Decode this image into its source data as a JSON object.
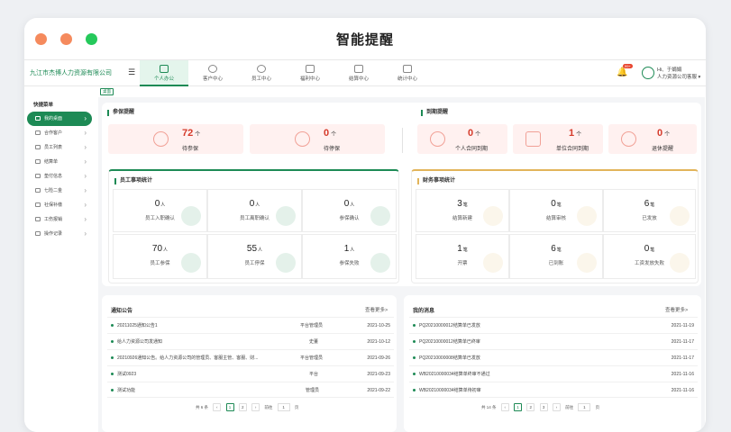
{
  "window": {
    "title": "智能提醒"
  },
  "topnav": {
    "company": "九江市杰博人力资源有限公司",
    "tabs": [
      {
        "label": "个人办公"
      },
      {
        "label": "客户中心"
      },
      {
        "label": "员工中心"
      },
      {
        "label": "福利中心"
      },
      {
        "label": "结算中心"
      },
      {
        "label": "统计中心"
      }
    ],
    "badge": "99+",
    "greeting": "Hi、于娟娟",
    "user_role": "人力资源公司客服 ▾"
  },
  "breadcrumb": "桌面",
  "sidebar": {
    "header": "快捷菜单",
    "items": [
      {
        "label": "我的桌面"
      },
      {
        "label": "合作客户"
      },
      {
        "label": "员工列表"
      },
      {
        "label": "结算单"
      },
      {
        "label": "垫付信息"
      },
      {
        "label": "七险二金"
      },
      {
        "label": "社保补缴"
      },
      {
        "label": "工伤报销"
      },
      {
        "label": "操作记录"
      }
    ]
  },
  "insurance": {
    "title": "参保提醒",
    "items": [
      {
        "num": "72",
        "unit": "个",
        "label": "待参保"
      },
      {
        "num": "0",
        "unit": "个",
        "label": "待停保"
      }
    ]
  },
  "expiry": {
    "title": "到期提醒",
    "items": [
      {
        "num": "0",
        "unit": "个",
        "label": "个人合同到期"
      },
      {
        "num": "1",
        "unit": "个",
        "label": "单位合同到期"
      },
      {
        "num": "0",
        "unit": "个",
        "label": "退休提醒"
      }
    ]
  },
  "staff": {
    "title": "员工事项统计",
    "items": [
      {
        "num": "0",
        "unit": "人",
        "label": "员工入职确认"
      },
      {
        "num": "0",
        "unit": "人",
        "label": "员工离职确认"
      },
      {
        "num": "0",
        "unit": "人",
        "label": "参保确认"
      },
      {
        "num": "70",
        "unit": "人",
        "label": "员工参保"
      },
      {
        "num": "55",
        "unit": "人",
        "label": "员工停保"
      },
      {
        "num": "1",
        "unit": "人",
        "label": "参保失败"
      }
    ]
  },
  "finance": {
    "title": "财务事项统计",
    "items": [
      {
        "num": "3",
        "unit": "笔",
        "label": "结算新建"
      },
      {
        "num": "0",
        "unit": "笔",
        "label": "结算审核"
      },
      {
        "num": "6",
        "unit": "笔",
        "label": "已发放"
      },
      {
        "num": "1",
        "unit": "笔",
        "label": "开票"
      },
      {
        "num": "6",
        "unit": "笔",
        "label": "已到账"
      },
      {
        "num": "0",
        "unit": "笔",
        "label": "工资发放失败"
      }
    ]
  },
  "notices": {
    "title": "通知公告",
    "more": "查看更多>",
    "rows": [
      {
        "text": "20211025通知公告1",
        "author": "平台管理员",
        "date": "2021-10-25"
      },
      {
        "text": "给人力资源公司发通知",
        "author": "史董",
        "date": "2021-10-12"
      },
      {
        "text": "20210926通知公告。给人力资源公司的管理员、客服主管、客服、财...",
        "author": "平台管理员",
        "date": "2021-09-26"
      },
      {
        "text": "测试0923",
        "author": "平台",
        "date": "2021-09-23"
      },
      {
        "text": "测试功能",
        "author": "管理员",
        "date": "2021-09-22"
      }
    ],
    "pager": {
      "total": "共 6 条",
      "prev": "‹",
      "p1": "1",
      "p2": "2",
      "next": "›",
      "goto": "前往",
      "page": "1",
      "suffix": "页"
    }
  },
  "messages": {
    "title": "我的消息",
    "more": "查看更多>",
    "rows": [
      {
        "text": "PQ20210000012结算单已发放",
        "date": "2021-11-19"
      },
      {
        "text": "PQ20210000012结算单已终审",
        "date": "2021-11-17"
      },
      {
        "text": "PQ20210000008结算单已发放",
        "date": "2021-11-17"
      },
      {
        "text": "WB20210000034结算单终审不通过",
        "date": "2021-11-16"
      },
      {
        "text": "WB20210000034结算单待初审",
        "date": "2021-11-16"
      }
    ],
    "pager": {
      "total": "共 14 条",
      "prev": "‹",
      "p1": "1",
      "p2": "2",
      "p3": "3",
      "next": "›",
      "goto": "前往",
      "page": "1",
      "suffix": "页"
    }
  },
  "colors": {
    "brand": "#1d8a55",
    "alert": "#d53a2a",
    "finance_accent": "#e2b45a"
  }
}
